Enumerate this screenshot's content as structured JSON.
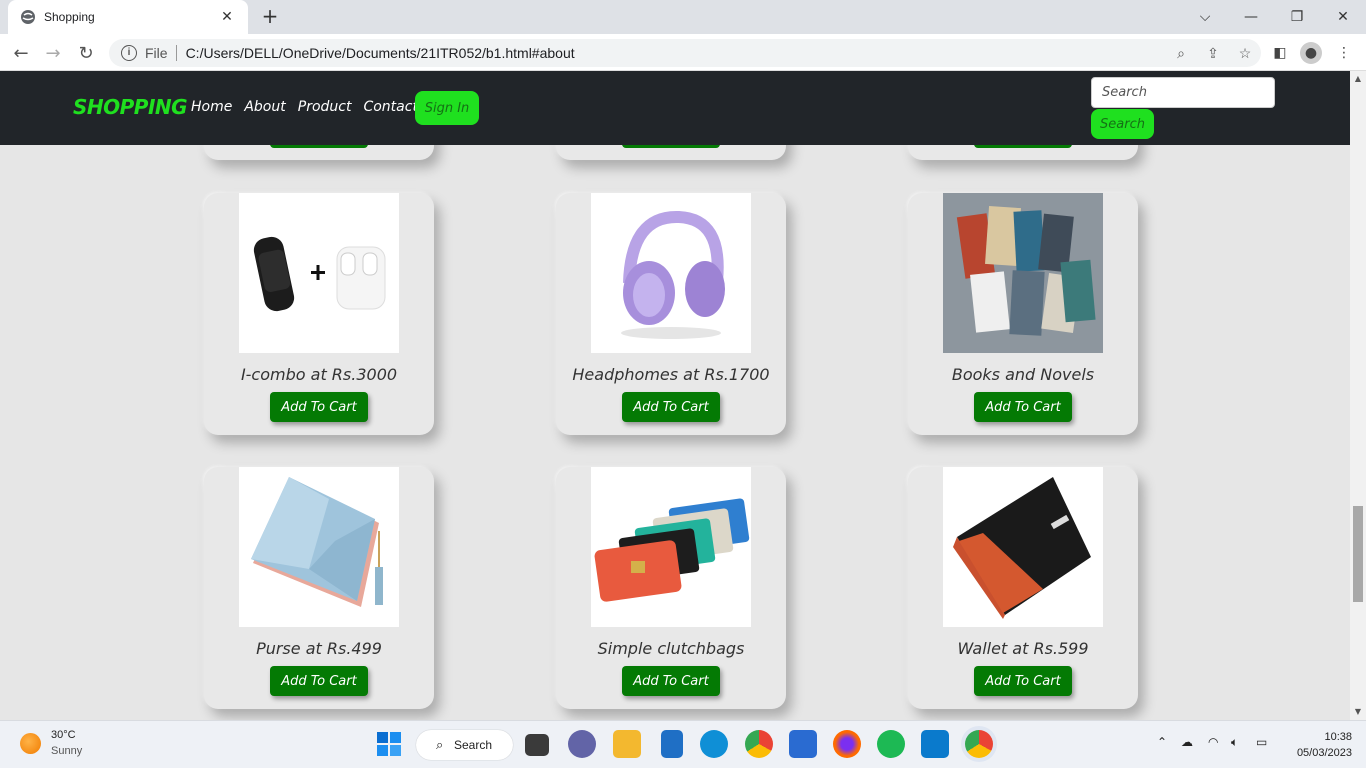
{
  "browser": {
    "tab_title": "Shopping",
    "new_tab": "+",
    "omnibox": {
      "scheme_label": "File",
      "url": "C:/Users/DELL/OneDrive/Documents/21ITR052/b1.html#about"
    }
  },
  "site": {
    "logo": "SHOPPING",
    "nav": [
      "Home",
      "About",
      "Product",
      "Contact"
    ],
    "signin_label": "Sign In",
    "search_placeholder": "Search",
    "search_button": "Search",
    "accent_color": "#1fe01f",
    "button_color": "#047a04"
  },
  "products": [
    {
      "title": "I-combo at Rs.3000",
      "button": "Add To Cart",
      "image": "watch-and-earbuds"
    },
    {
      "title": "Headphomes at Rs.1700",
      "button": "Add To Cart",
      "image": "purple-headphones"
    },
    {
      "title": "Books and Novels",
      "button": "Add To Cart",
      "image": "books-stack"
    },
    {
      "title": "Purse at Rs.499",
      "button": "Add To Cart",
      "image": "blue-purse"
    },
    {
      "title": "Simple clutchbags",
      "button": "Add To Cart",
      "image": "clutch-bags"
    },
    {
      "title": "Wallet at Rs.599",
      "button": "Add To Cart",
      "image": "black-wallet"
    }
  ],
  "taskbar": {
    "weather_temp": "30°C",
    "weather_desc": "Sunny",
    "search_label": "Search",
    "time": "10:38",
    "date": "05/03/2023"
  }
}
